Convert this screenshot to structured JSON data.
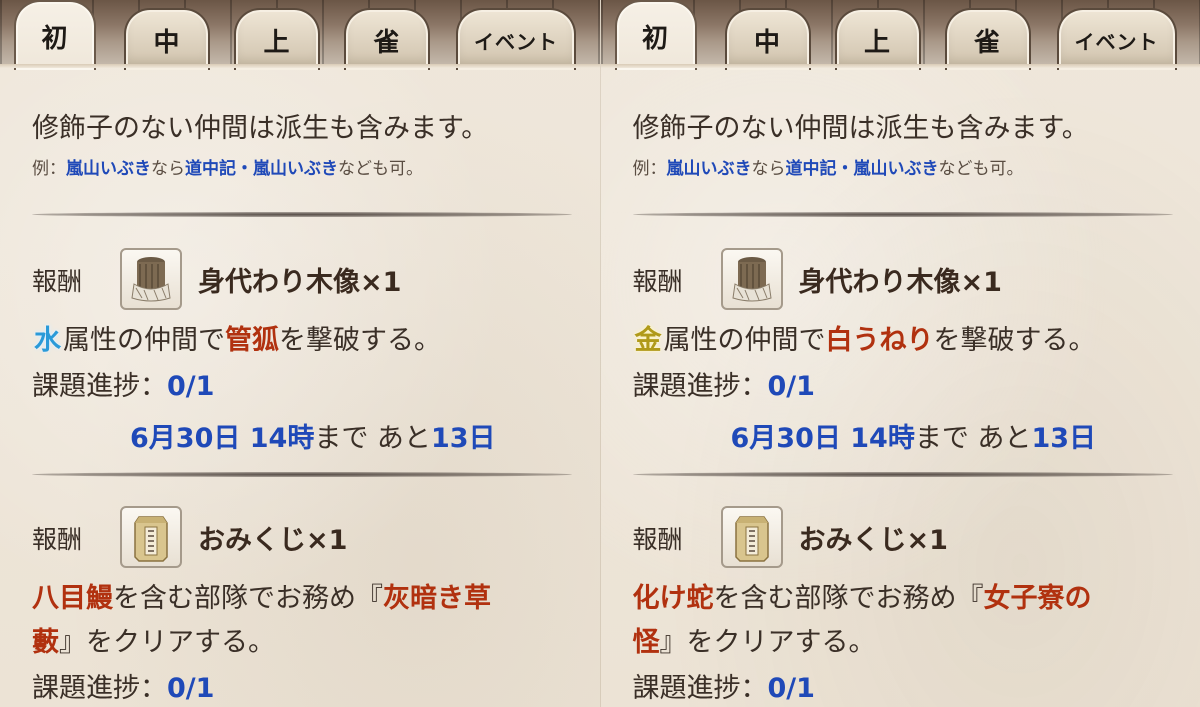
{
  "panels": [
    {
      "tabs": [
        {
          "label": "初",
          "active": true
        },
        {
          "label": "中",
          "active": false
        },
        {
          "label": "上",
          "active": false
        },
        {
          "label": "雀",
          "active": false
        },
        {
          "label": "イベント",
          "active": false
        }
      ],
      "note": {
        "main": "修飾子のない仲間は派生も含みます。",
        "sub_prefix": "例：",
        "sub_a": "嵐山いぶき",
        "sub_mid": "なら",
        "sub_b": "道中記・嵐山いぶき",
        "sub_suffix": "なども可。"
      },
      "quest1": {
        "reward_label": "報酬",
        "reward_icon": "wooden-statue-icon",
        "reward_name": "身代わり木像×1",
        "attr": "水",
        "text_a": "属性の仲間で",
        "target": "管狐",
        "text_b": "を撃破する。",
        "progress_label": "課題進捗：",
        "progress": "0/1",
        "deadline_date": "6月30日 14時",
        "deadline_until": "まで あと",
        "deadline_days": "13日"
      },
      "quest2": {
        "reward_label": "報酬",
        "reward_icon": "omikuji-box-icon",
        "reward_name": "おみくじ×1",
        "target": "八目鰻",
        "text_a": "を含む部隊でお務め『",
        "mission_a": "灰暗き草",
        "mission_b": "藪",
        "text_b": "』をクリアする。",
        "progress_label": "課題進捗：",
        "progress": "0/1"
      }
    },
    {
      "tabs": [
        {
          "label": "初",
          "active": true
        },
        {
          "label": "中",
          "active": false
        },
        {
          "label": "上",
          "active": false
        },
        {
          "label": "雀",
          "active": false
        },
        {
          "label": "イベント",
          "active": false
        }
      ],
      "note": {
        "main": "修飾子のない仲間は派生も含みます。",
        "sub_prefix": "例：",
        "sub_a": "嵐山いぶき",
        "sub_mid": "なら",
        "sub_b": "道中記・嵐山いぶき",
        "sub_suffix": "なども可。"
      },
      "quest1": {
        "reward_label": "報酬",
        "reward_icon": "wooden-statue-icon",
        "reward_name": "身代わり木像×1",
        "attr": "金",
        "text_a": "属性の仲間で",
        "target": "白うねり",
        "text_b": "を撃破する。",
        "progress_label": "課題進捗：",
        "progress": "0/1",
        "deadline_date": "6月30日 14時",
        "deadline_until": "まで あと",
        "deadline_days": "13日"
      },
      "quest2": {
        "reward_label": "報酬",
        "reward_icon": "omikuji-box-icon",
        "reward_name": "おみくじ×1",
        "target": "化け蛇",
        "text_a": "を含む部隊でお務め『",
        "mission_a": "女子寮の",
        "mission_b": "怪",
        "text_b": "』をクリアする。",
        "progress_label": "課題進捗：",
        "progress": "0/1"
      }
    }
  ],
  "colors": {
    "link_blue": "#1f49b8",
    "target_red": "#b1310f",
    "text_brown": "#3a2f27",
    "water_attr": "#2a9ad8",
    "metal_attr": "#b09a1a"
  }
}
